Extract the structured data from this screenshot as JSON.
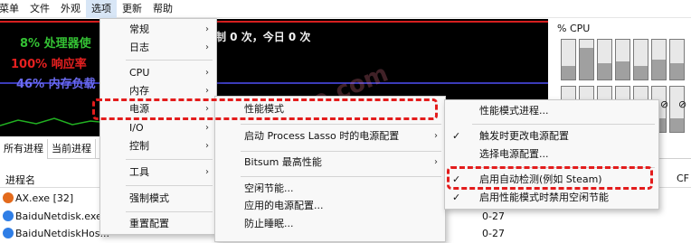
{
  "menubar": [
    "主菜单",
    "文件",
    "外观",
    "选项",
    "更新",
    "帮助"
  ],
  "graph": {
    "cpu_text": "8% 处理器使",
    "response_text": "100% 响应率",
    "memory_text": "46% 内存负载",
    "restrain_text": "制 0 次，今日 0 次",
    "colors": {
      "cpu": "#34c234",
      "response": "#e62020",
      "memory": "#6a6af0"
    }
  },
  "cpu_panel": {
    "title": "% CPU",
    "bars_top_load": [
      0.35,
      0.8,
      0.4,
      0.45,
      0.35,
      0.5,
      0.4
    ],
    "bars_bottom_load": [
      0.5,
      0.3,
      0.3,
      0.4,
      0.6,
      0.3,
      0.3
    ],
    "bottom_right_icons": [
      "leaf-icon",
      "leaf-icon"
    ]
  },
  "tabs": [
    "所有进程",
    "当前进程"
  ],
  "table": {
    "header_name": "进程名",
    "header_right": "CF",
    "rows": [
      {
        "name": "AX.exe [32]",
        "value": "",
        "icon": "app-icon"
      },
      {
        "name": "BaiduNetdisk.exe",
        "value": "0-27",
        "icon": "baidu-icon"
      },
      {
        "name": "BaiduNetdiskHos...",
        "value": "0-27",
        "icon": "baidu-icon"
      }
    ]
  },
  "options_menu": {
    "items": [
      "常规",
      "日志",
      "CPU",
      "内存",
      "电源",
      "I/O",
      "控制",
      "工具",
      "强制模式",
      "重置配置"
    ]
  },
  "power_menu": {
    "items": [
      "性能模式",
      "启动 Process Lasso 时的电源配置",
      "Bitsum 最高性能",
      "空闲节能...",
      "应用的电源配置...",
      "防止睡眠..."
    ]
  },
  "performance_menu": {
    "items": [
      "性能模式进程...",
      "触发时更改电源配置",
      "选择电源配置...",
      "启用自动检测(例如 Steam)",
      "启用性能模式时禁用空闲节能"
    ]
  },
  "watermark": "记得收藏 Hybase.com"
}
